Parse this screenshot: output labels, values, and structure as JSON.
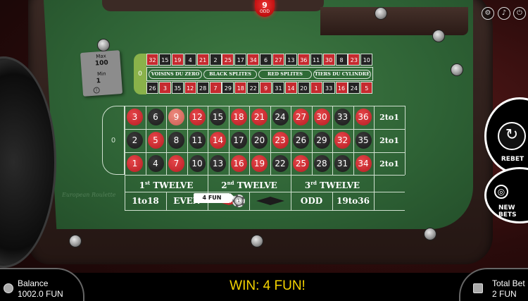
{
  "result": {
    "number": "9",
    "parity": "ODD"
  },
  "limits": {
    "max_label": "Max",
    "max_value": "100",
    "min_label": "Min",
    "min_value": "1"
  },
  "racetrack": {
    "zero": "0",
    "top_row": [
      "32",
      "15",
      "19",
      "4",
      "21",
      "2",
      "25",
      "17",
      "34",
      "6",
      "27",
      "13",
      "36",
      "11",
      "30",
      "8",
      "23",
      "10"
    ],
    "bottom_row": [
      "26",
      "3",
      "35",
      "12",
      "28",
      "7",
      "29",
      "18",
      "22",
      "9",
      "31",
      "14",
      "20",
      "1",
      "33",
      "16",
      "24",
      "5"
    ],
    "sections": [
      "VOISINS DU ZERO",
      "BLACK SPLITES",
      "RED SPLITES",
      "TIERS DU CYLINDRE"
    ]
  },
  "board": {
    "zero": "0",
    "row_top": [
      "3",
      "6",
      "9",
      "12",
      "15",
      "18",
      "21",
      "24",
      "27",
      "30",
      "33",
      "36"
    ],
    "row_mid": [
      "2",
      "5",
      "8",
      "11",
      "14",
      "17",
      "20",
      "23",
      "26",
      "29",
      "32",
      "35"
    ],
    "row_bot": [
      "1",
      "4",
      "7",
      "10",
      "13",
      "16",
      "19",
      "22",
      "25",
      "28",
      "31",
      "34"
    ],
    "columns": [
      "2to1",
      "2to1",
      "2to1"
    ],
    "dozens": {
      "d1_n": "1",
      "d1_sup": "st",
      "d1_t": "TWELVE",
      "d2_n": "2",
      "d2_sup": "nd",
      "d2_t": "TWELVE",
      "d3_n": "3",
      "d3_sup": "rd",
      "d3_t": "TWELVE"
    },
    "low": "1to18",
    "even": "EVEN",
    "odd": "ODD",
    "high": "19to36",
    "watermark": "European Roulette"
  },
  "bet_tag": "4 FUN",
  "controls": {
    "rebet": "REBET",
    "new_bets": "NEW BETS"
  },
  "footer": {
    "balance_label": "Balance",
    "balance_value": "1002.0 FUN",
    "win_text": "WIN: 4 FUN!",
    "total_label": "Total Bet",
    "total_value": "2 FUN"
  },
  "colors": {
    "red": "#c62a2f",
    "black": "#232323",
    "felt": "#2e6235",
    "win": "#f5d400"
  }
}
